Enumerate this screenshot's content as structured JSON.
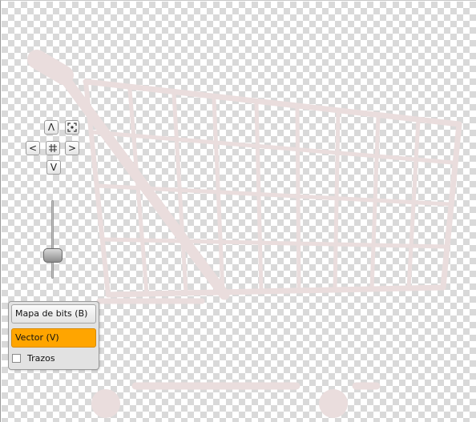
{
  "navigation": {
    "pan_up_label": "Λ",
    "pan_down_label": "V",
    "pan_left_label": "<",
    "pan_right_label": ">",
    "zoom_fit_icon": "zoom-fit-icon",
    "center_icon": "center-icon"
  },
  "zoom_slider": {
    "level": 0.25
  },
  "mode_panel": {
    "bitmap_label": "Mapa de bits (B)",
    "vector_label": "Vector (V)",
    "strokes_label": "Trazos",
    "strokes_checked": false,
    "active_mode": "vector",
    "active_color": "#ffa500"
  },
  "canvas": {
    "background": "transparency-checkerboard",
    "image": "shopping-cart",
    "image_color": "#eadddd"
  }
}
